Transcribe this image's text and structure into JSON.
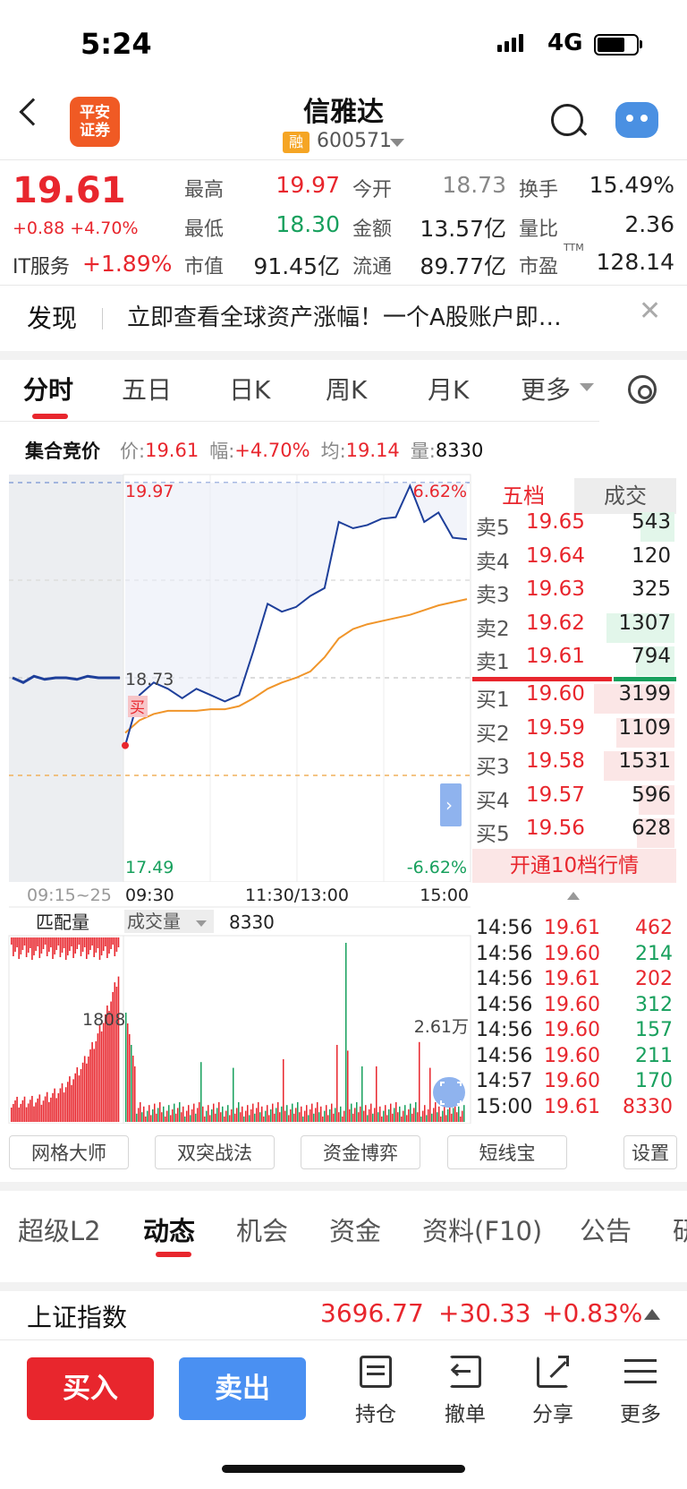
{
  "status": {
    "time": "5:24",
    "network": "4G"
  },
  "header": {
    "logo_text_1": "平安",
    "logo_text_2": "证券",
    "stock_name": "信雅达",
    "margin_badge": "融",
    "stock_code": "600571"
  },
  "quote": {
    "last_price": "19.61",
    "change": "+0.88 +4.70%",
    "sector": "IT服务",
    "sector_change": "+1.89%",
    "fields": [
      {
        "label": "最高",
        "value": "19.97",
        "color": "red"
      },
      {
        "label": "今开",
        "value": "18.73",
        "color": "gray"
      },
      {
        "label": "换手",
        "value": "15.49%",
        "color": "black"
      },
      {
        "label": "最低",
        "value": "18.30",
        "color": "green"
      },
      {
        "label": "金额",
        "value": "13.57亿",
        "color": "black"
      },
      {
        "label": "量比",
        "value": "2.36",
        "color": "black"
      },
      {
        "label": "市值",
        "value": "91.45亿",
        "color": "black"
      },
      {
        "label": "流通",
        "value": "89.77亿",
        "color": "black"
      },
      {
        "label": "市盈",
        "value": "128.14",
        "color": "black"
      }
    ],
    "pe_superscript": "TTM"
  },
  "discover": {
    "title": "发现",
    "text": "立即查看全球资产涨幅！一个A股账户即…"
  },
  "chart_tabs": [
    "分时",
    "五日",
    "日K",
    "周K",
    "月K",
    "更多"
  ],
  "auction": {
    "title": "集合竞价",
    "price_label": "价:",
    "price": "19.61",
    "range_label": "幅:",
    "range": "+4.70%",
    "avg_label": "均:",
    "avg": "19.14",
    "vol_label": "量:",
    "vol": "8330"
  },
  "chart_labels": {
    "high": "19.97",
    "high_pct": "6.62%",
    "open": "18.73",
    "low": "17.49",
    "low_pct": "-6.62%",
    "buy_marker": "买",
    "pre_axis": "09:15~25",
    "x_ticks": [
      "09:30",
      "11:30/13:00",
      "15:00"
    ],
    "match_volume": "匹配量",
    "volume_select": "成交量",
    "volume_value": "8330",
    "pre_vol_label": "1808",
    "vol_max_label": "2.61万"
  },
  "chart_data": {
    "type": "line",
    "title": "",
    "ylim": [
      17.49,
      19.97
    ],
    "prev_close": 18.73,
    "pre_auction_price": [
      18.73,
      18.7,
      18.74,
      18.72,
      18.73,
      18.73,
      18.72,
      18.74,
      18.73,
      18.73,
      18.73
    ],
    "x": [
      "09:30",
      "09:40",
      "09:50",
      "10:00",
      "10:10",
      "10:20",
      "10:30",
      "10:40",
      "10:50",
      "11:00",
      "11:10",
      "11:20",
      "11:30",
      "13:10",
      "13:20",
      "13:30",
      "13:40",
      "13:50",
      "14:00",
      "14:10",
      "14:20",
      "14:30",
      "14:40",
      "14:50",
      "15:00"
    ],
    "series": [
      {
        "values": [
          18.3,
          18.62,
          18.7,
          18.66,
          18.6,
          18.66,
          18.62,
          18.58,
          18.62,
          18.9,
          19.2,
          19.15,
          19.18,
          19.25,
          19.3,
          19.72,
          19.68,
          19.7,
          19.74,
          19.75,
          19.95,
          19.72,
          19.78,
          19.62,
          19.61
        ]
      },
      {
        "values": [
          18.38,
          18.46,
          18.5,
          18.52,
          18.52,
          18.52,
          18.53,
          18.53,
          18.55,
          18.6,
          18.66,
          18.7,
          18.73,
          18.77,
          18.86,
          18.98,
          19.04,
          19.07,
          19.09,
          19.11,
          19.13,
          19.16,
          19.19,
          19.21,
          19.23
        ]
      }
    ]
  },
  "order_book": {
    "tab_levels": "五档",
    "tab_trades": "成交",
    "asks": [
      {
        "label": "卖5",
        "price": "19.65",
        "vol": "543",
        "bar": 0.42
      },
      {
        "label": "卖4",
        "price": "19.64",
        "vol": "120",
        "bar": 0
      },
      {
        "label": "卖3",
        "price": "19.63",
        "vol": "325",
        "bar": 0
      },
      {
        "label": "卖2",
        "price": "19.62",
        "vol": "1307",
        "bar": 0.85
      },
      {
        "label": "卖1",
        "price": "19.61",
        "vol": "794",
        "bar": 0.48
      }
    ],
    "bids": [
      {
        "label": "买1",
        "price": "19.60",
        "vol": "3199",
        "bar": 1.0
      },
      {
        "label": "买2",
        "price": "19.59",
        "vol": "1109",
        "bar": 0.72
      },
      {
        "label": "买3",
        "price": "19.58",
        "vol": "1531",
        "bar": 0.88
      },
      {
        "label": "买4",
        "price": "19.57",
        "vol": "596",
        "bar": 0.45
      },
      {
        "label": "买5",
        "price": "19.56",
        "vol": "628",
        "bar": 0.47
      }
    ],
    "upgrade": "开通10档行情"
  },
  "trades": [
    {
      "time": "14:56",
      "price": "19.61",
      "vol": "462",
      "side": "red"
    },
    {
      "time": "14:56",
      "price": "19.60",
      "vol": "214",
      "side": "green"
    },
    {
      "time": "14:56",
      "price": "19.61",
      "vol": "202",
      "side": "red"
    },
    {
      "time": "14:56",
      "price": "19.60",
      "vol": "312",
      "side": "green"
    },
    {
      "time": "14:56",
      "price": "19.60",
      "vol": "157",
      "side": "green"
    },
    {
      "time": "14:56",
      "price": "19.60",
      "vol": "211",
      "side": "green"
    },
    {
      "time": "14:57",
      "price": "19.60",
      "vol": "170",
      "side": "green"
    },
    {
      "time": "15:00",
      "price": "19.61",
      "vol": "8330",
      "side": "red"
    }
  ],
  "tools": [
    "网格大师",
    "双突战法",
    "资金博弈",
    "短线宝",
    "设置"
  ],
  "bottom_tabs": [
    "超级L2",
    "动态",
    "机会",
    "资金",
    "资料(F10)",
    "公告",
    "研"
  ],
  "index": {
    "name": "上证指数",
    "value": "3696.77",
    "change": "+30.33",
    "pct": "+0.83%"
  },
  "actions": {
    "buy": "买入",
    "sell": "卖出"
  },
  "nav": [
    "持仓",
    "撤单",
    "分享",
    "更多"
  ],
  "colors": {
    "up": "#e8262d",
    "down": "#17a05d",
    "accent": "#4a90f2",
    "price_line": "#1e3f9a",
    "avg_line": "#f0952a"
  }
}
